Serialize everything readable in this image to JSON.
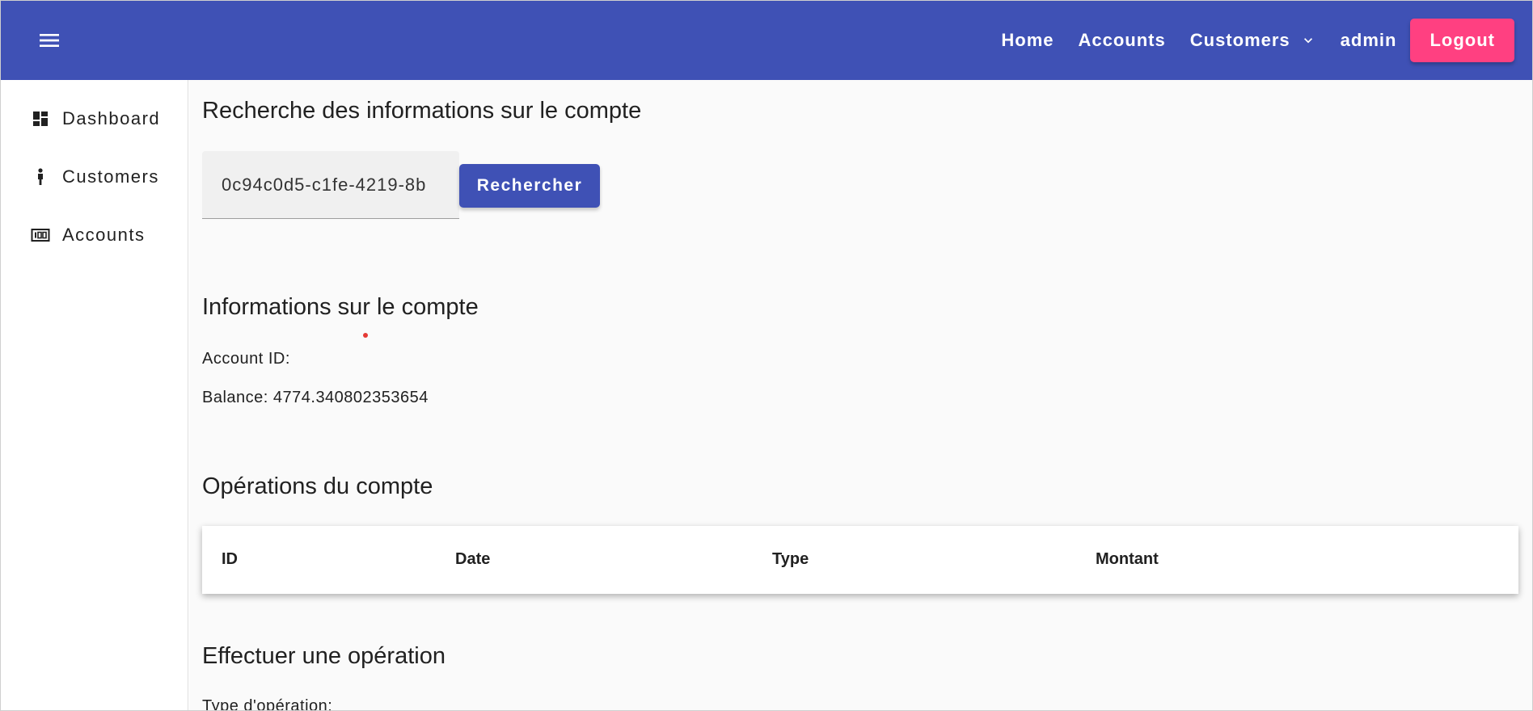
{
  "toolbar": {
    "menu_icon": "menu-icon",
    "links": {
      "home": "Home",
      "accounts": "Accounts",
      "customers": "Customers",
      "user": "admin"
    },
    "logout_label": "Logout",
    "colors": {
      "primary": "#3f51b5",
      "accent": "#ff4081"
    }
  },
  "sidebar": {
    "items": [
      {
        "label": "Dashboard",
        "icon": "dashboard-icon"
      },
      {
        "label": "Customers",
        "icon": "person-icon"
      },
      {
        "label": "Accounts",
        "icon": "account-balance-icon"
      }
    ]
  },
  "search": {
    "title": "Recherche des informations sur le compte",
    "input_value": "0c94c0d5-c1fe-4219-8b",
    "button_label": "Rechercher"
  },
  "account_info": {
    "title": "Informations sur le compte",
    "account_id_label": "Account ID:",
    "balance_text": "Balance: 4774.340802353654"
  },
  "operations": {
    "title": "Opérations du compte",
    "columns": [
      "ID",
      "Date",
      "Type",
      "Montant"
    ],
    "rows": []
  },
  "perform_operation": {
    "title": "Effectuer une opération",
    "type_label": "Type d'opération:"
  }
}
